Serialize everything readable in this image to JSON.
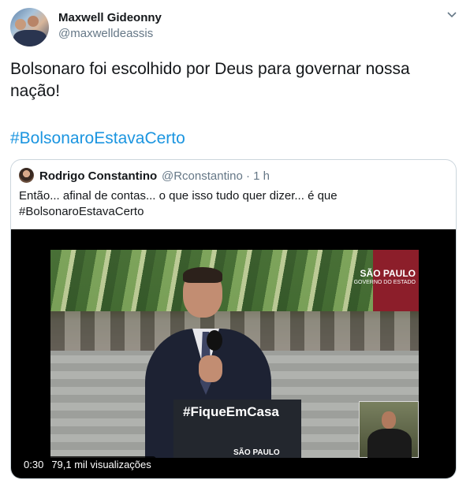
{
  "tweet": {
    "author": {
      "name": "Maxwell Gideonny",
      "handle": "@maxwelldeassis"
    },
    "text": "Bolsonaro foi escolhido por Deus para governar nossa nação!",
    "hashtag": "#BolsonaroEstavaCerto",
    "menu_icon": "chevron-down-icon"
  },
  "quoted": {
    "author": {
      "name": "Rodrigo Constantino",
      "handle": "@Rconstantino · 1 h"
    },
    "text": "Então... afinal de contas... o que isso tudo quer dizer... é que #BolsonaroEstavaCerto",
    "video": {
      "duration": "0:30",
      "views": "79,1 mil visualizações",
      "podium_text": "#FiqueEmCasa",
      "logo_text": "SÃO PAULO",
      "logo_subtext": "GOVERNO DO ESTADO",
      "podium_logo": "SÃO PAULO"
    }
  },
  "colors": {
    "link": "#1b95e0",
    "secondary_text": "#657786",
    "border": "#ccd6dd"
  }
}
